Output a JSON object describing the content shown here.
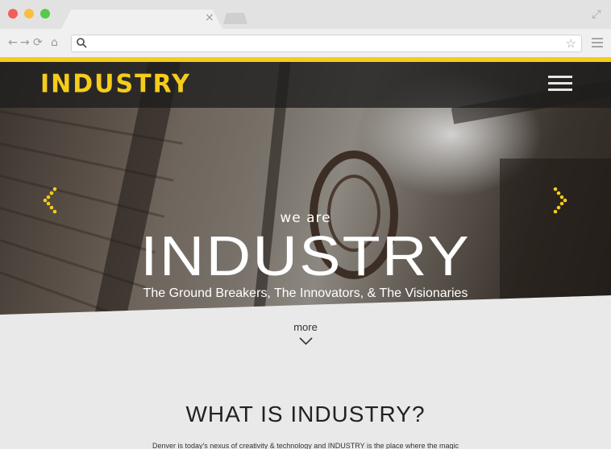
{
  "browser": {
    "tab_close": "×",
    "address_value": "",
    "star_icon": "star-icon",
    "expand_icon": "expand-icon"
  },
  "site": {
    "logo": "INDUSTRY",
    "accent_color": "#f5cc1a"
  },
  "hero": {
    "we_are": "we are",
    "title": "INDUSTRY",
    "subtitle": "The Ground Breakers, The Innovators, & The Visionaries"
  },
  "more": {
    "label": "more"
  },
  "section": {
    "title": "WHAT IS INDUSTRY?",
    "body": "Denver is today's nexus of creativity & technology and INDUSTRY is the place where the magic"
  }
}
